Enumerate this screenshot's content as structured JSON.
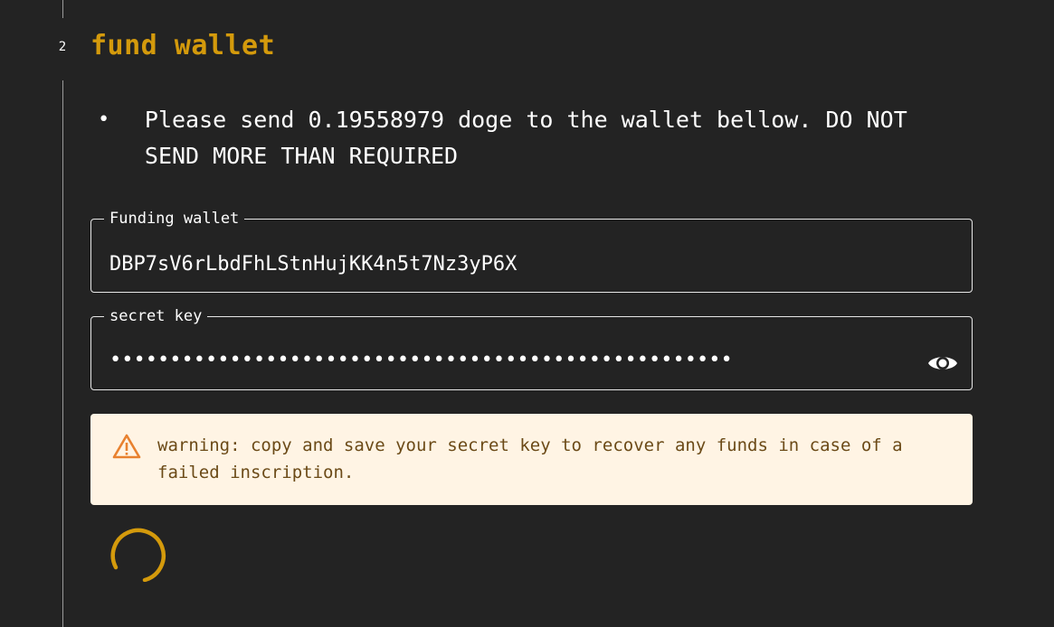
{
  "step": {
    "number": "2",
    "title": "fund wallet"
  },
  "instruction": {
    "bullet": "•",
    "text": "Please send 0.19558979 doge to the wallet bellow. DO NOT SEND MORE THAN REQUIRED"
  },
  "funding_wallet": {
    "label": "Funding wallet",
    "value": "DBP7sV6rLbdFhLStnHujKK4n5t7Nz3yP6X"
  },
  "secret_key": {
    "label": "secret key",
    "masked_value": "••••••••••••••••••••••••••••••••••••••••••••••••••••",
    "visibility_icon": "eye-icon"
  },
  "warning": {
    "icon": "warning-triangle-icon",
    "text": "warning: copy and save your secret key to recover any funds in case of a failed inscription.",
    "colors": {
      "background": "#fff4e4",
      "text": "#6b4a17",
      "icon": "#e8812f"
    }
  },
  "loading": {
    "icon": "spinner-icon"
  },
  "colors": {
    "background": "#232323",
    "accent": "#d49a0c",
    "text": "#ffffff"
  }
}
